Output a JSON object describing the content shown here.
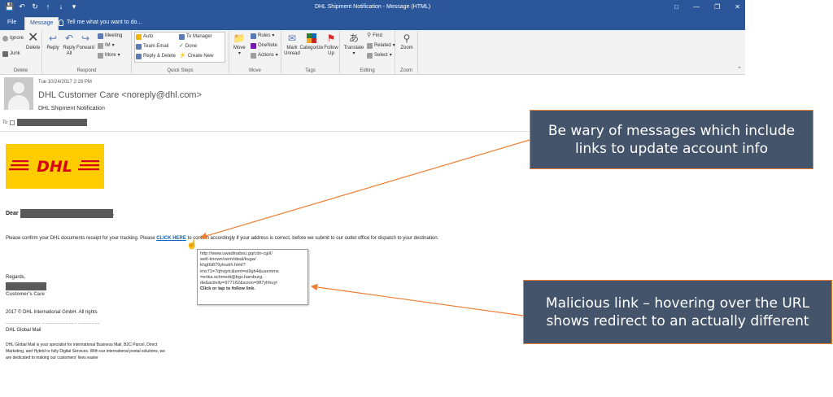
{
  "window": {
    "title": "DHL Shipment Notification - Message (HTML)"
  },
  "tabs": {
    "file": "File",
    "message": "Message",
    "tell_me": "Tell me what you want to do..."
  },
  "ribbon": {
    "delete_group": {
      "label": "Delete",
      "ignore": "Ignore",
      "junk": "Junk",
      "delete": "Delete"
    },
    "respond_group": {
      "label": "Respond",
      "reply": "Reply",
      "reply_all": "Reply All",
      "forward": "Forward",
      "meeting": "Meeting",
      "im": "IM",
      "more": "More"
    },
    "quick_steps_group": {
      "label": "Quick Steps",
      "auto": "Auto",
      "team_email": "Team Email",
      "reply_delete": "Reply & Delete",
      "to_manager": "To Manager",
      "done": "Done",
      "create_new": "Create New"
    },
    "move_group": {
      "label": "Move",
      "move": "Move",
      "rules": "Rules",
      "onenote": "OneNote",
      "actions": "Actions"
    },
    "tags_group": {
      "label": "Tags",
      "mark_unread": "Mark Unread",
      "categorize": "Categorize",
      "follow_up": "Follow Up"
    },
    "editing_group": {
      "label": "Editing",
      "translate": "Translate",
      "find": "Find",
      "related": "Related",
      "select": "Select"
    },
    "zoom_group": {
      "label": "Zoom",
      "zoom": "Zoom"
    }
  },
  "header": {
    "date": "Tue 10/24/2017 2:28 PM",
    "sender": "DHL Customer Care <noreply@dhl.com>",
    "subject": "DHL Shipment Notification",
    "to_label": "To"
  },
  "body": {
    "logo_text": "DHL",
    "dear": "Dear",
    "confirm_before": "Please confirm your DHL documents receipt for your tracking. Please ",
    "click_here": "CLICK HERE",
    "confirm_after": " to confirm accordingly if your address is correct, before we submit to our outlet office for dispatch to your destination.",
    "tooltip_lines": [
      "http://www.uwadinabsu.gq/cdn-cgi/l/",
      "well-known/xem/ideal/kuga/",
      "khgt6i879yloukh.html?",
      "imx71=7qhvjytc&emt=oi9gh4&usemms",
      "=erika.schmedt@bgv.hamburg.",
      "de&activity=977162&scion=987yhhuyt"
    ],
    "tooltip_action": "Click or tap to follow link.",
    "regards": "Regards,",
    "customers_care": "Customer's Care",
    "copyright": "2017 © DHL International GmbH. All rights",
    "dots": "...............................  ...............................  ...................",
    "dhl_global_mail": "DHL  Global Mail",
    "description": "DHL Global Mail is your specialist for international Business Mail, B2C Parcel, Direct Marketing, and Hybrid or fully Digital Services. With our international postal solutions, we are dedicated to making our customers' lives easier"
  },
  "annotations": {
    "callout1": "Be wary of messages which include links to update account info",
    "callout2": "Malicious link – hovering over the URL shows redirect to an actually different"
  },
  "colors": {
    "title_bar": "#2b579a",
    "callout_fill": "#44546a",
    "callout_border": "#ed7d31",
    "dhl_yellow": "#ffcc00",
    "dhl_red": "#d40511",
    "link": "#0563c1"
  }
}
